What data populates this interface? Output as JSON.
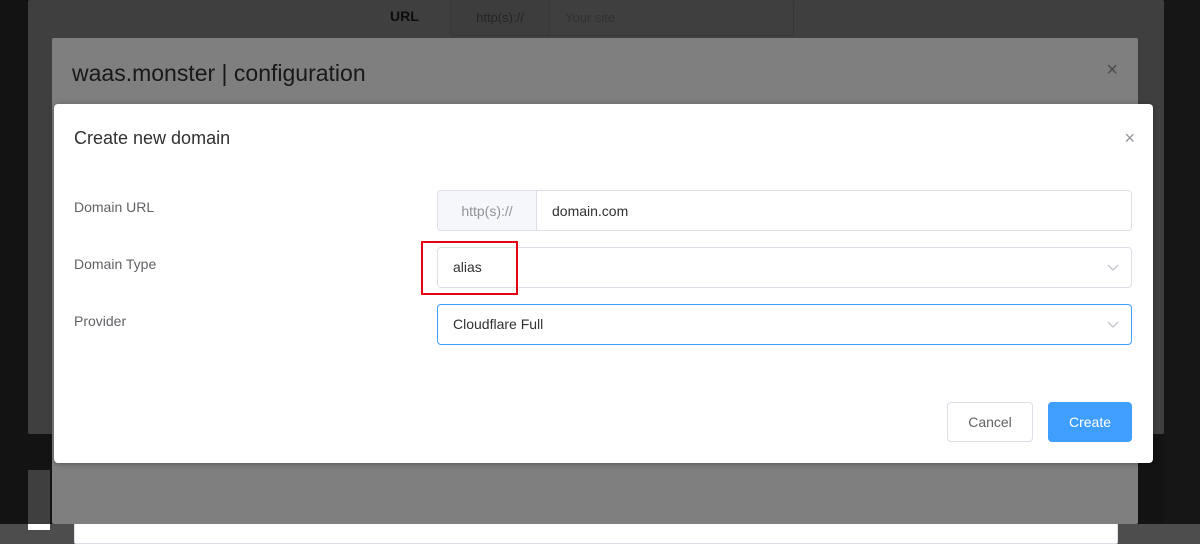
{
  "background": {
    "url_label": "URL",
    "url_prefix": "http(s)://",
    "url_placeholder": "Your site"
  },
  "config_dialog": {
    "title": "waas.monster | configuration",
    "close_glyph": "×"
  },
  "create_dialog": {
    "title": "Create new domain",
    "close_glyph": "×",
    "fields": {
      "domain_url": {
        "label": "Domain URL",
        "prefix": "http(s)://",
        "value": "domain.com"
      },
      "domain_type": {
        "label": "Domain Type",
        "value": "alias"
      },
      "provider": {
        "label": "Provider",
        "value": "Cloudflare Full"
      }
    },
    "buttons": {
      "cancel": "Cancel",
      "create": "Create"
    }
  },
  "colors": {
    "primary": "#409eff",
    "highlight": "#e60012",
    "text": "#303133",
    "label": "#606266",
    "border": "#dcdfe6"
  },
  "icons": {
    "close": "close-icon",
    "dropdown": "chevron-down-icon"
  }
}
